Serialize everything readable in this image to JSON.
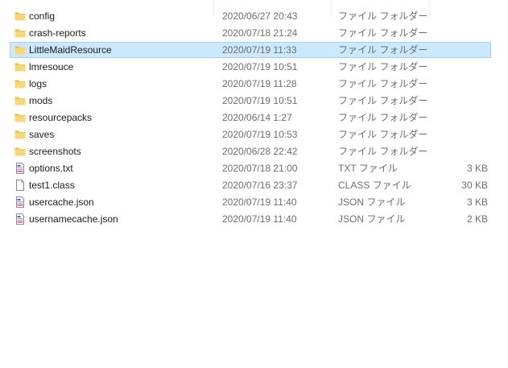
{
  "files": [
    {
      "name": "config",
      "date": "2020/06/27 20:43",
      "type": "ファイル フォルダー",
      "size": "",
      "icon": "folder-icon",
      "selected": false
    },
    {
      "name": "crash-reports",
      "date": "2020/07/18 21:24",
      "type": "ファイル フォルダー",
      "size": "",
      "icon": "folder-icon",
      "selected": false
    },
    {
      "name": "LittleMaidResource",
      "date": "2020/07/19 11:33",
      "type": "ファイル フォルダー",
      "size": "",
      "icon": "folder-icon",
      "selected": true
    },
    {
      "name": "lmresouce",
      "date": "2020/07/19 10:51",
      "type": "ファイル フォルダー",
      "size": "",
      "icon": "folder-icon",
      "selected": false
    },
    {
      "name": "logs",
      "date": "2020/07/19 11:28",
      "type": "ファイル フォルダー",
      "size": "",
      "icon": "folder-icon",
      "selected": false
    },
    {
      "name": "mods",
      "date": "2020/07/19 10:51",
      "type": "ファイル フォルダー",
      "size": "",
      "icon": "folder-icon",
      "selected": false
    },
    {
      "name": "resourcepacks",
      "date": "2020/06/14 1:27",
      "type": "ファイル フォルダー",
      "size": "",
      "icon": "folder-icon",
      "selected": false
    },
    {
      "name": "saves",
      "date": "2020/07/19 10:53",
      "type": "ファイル フォルダー",
      "size": "",
      "icon": "folder-icon",
      "selected": false
    },
    {
      "name": "screenshots",
      "date": "2020/06/28 22:42",
      "type": "ファイル フォルダー",
      "size": "",
      "icon": "folder-icon",
      "selected": false
    },
    {
      "name": "options.txt",
      "date": "2020/07/18 21:00",
      "type": "TXT ファイル",
      "size": "3 KB",
      "icon": "text-file-icon",
      "selected": false
    },
    {
      "name": "test1.class",
      "date": "2020/07/16 23:37",
      "type": "CLASS ファイル",
      "size": "30 KB",
      "icon": "blank-file-icon",
      "selected": false
    },
    {
      "name": "usercache.json",
      "date": "2020/07/19 11:40",
      "type": "JSON ファイル",
      "size": "3 KB",
      "icon": "text-file-icon",
      "selected": false
    },
    {
      "name": "usernamecache.json",
      "date": "2020/07/19 11:40",
      "type": "JSON ファイル",
      "size": "2 KB",
      "icon": "text-file-icon",
      "selected": false
    }
  ],
  "colors": {
    "folder": "#f8d775",
    "folder_tab": "#e8b74a",
    "selection_bg": "#cce8ff",
    "selection_border": "#99d1ff",
    "secondary_text": "#6d6d6d"
  }
}
